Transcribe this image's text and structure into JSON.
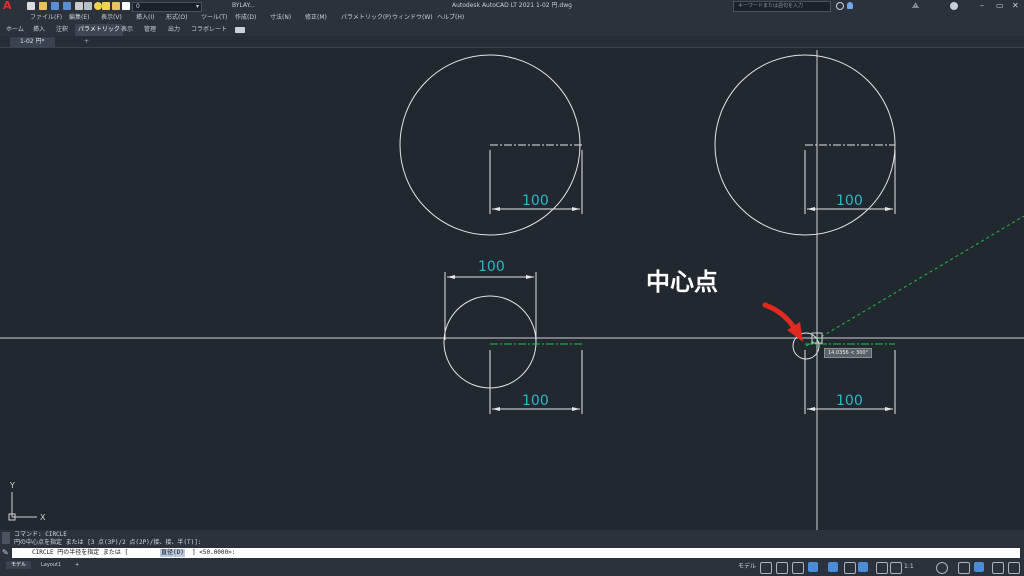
{
  "app": {
    "title": "Autodesk AutoCAD LT 2021    1-02 円.dwg",
    "search_placeholder": "キーワードまたは語句を入力",
    "layer_value": "0",
    "linetype_value": "BYLAY..."
  },
  "menu": {
    "items": [
      "ファイル(F)",
      "編集(E)",
      "表示(V)",
      "挿入(I)",
      "形式(O)",
      "ツール(T)",
      "作成(D)",
      "寸法(N)",
      "修正(M)",
      "パラメトリック(P)",
      "ウィンドウ(W)",
      "ヘルプ(H)"
    ]
  },
  "ribbon": {
    "tabs": [
      "ホーム",
      "挿入",
      "注釈",
      "パラメトリック",
      "表示",
      "管理",
      "出力",
      "コラボレート"
    ],
    "active_tab": "パラメトリック"
  },
  "document": {
    "tab_label": "1-02 円*",
    "add_tab": "+"
  },
  "drawing": {
    "dimension_values": [
      "100",
      "100",
      "100",
      "100",
      "100",
      "100"
    ],
    "tooltip": "14.0356 < 300°",
    "annotation": "中心点",
    "ucs_y": "Y",
    "ucs_x": "X"
  },
  "command": {
    "history_1": "コマンド: CIRCLE",
    "history_2": "円の中心点を指定 または [3 点(3P)/2 点(2P)/接、接、半(T)]:",
    "prompt_prefix": "CIRCLE 円の半径を指定 または [",
    "prompt_option": "直径(D)",
    "prompt_suffix": "] <50.0000>:"
  },
  "layouts": {
    "tabs": [
      "モデル",
      "Layout1"
    ],
    "add": "+"
  },
  "status": {
    "model_label": "モデル",
    "scale": "1:1"
  },
  "colors": {
    "background": "#212830",
    "geometry": "#e6e6e6",
    "dimension": "#2bb8c5",
    "centerline": "#1fbf3f",
    "arrow": "#e02a1f"
  }
}
